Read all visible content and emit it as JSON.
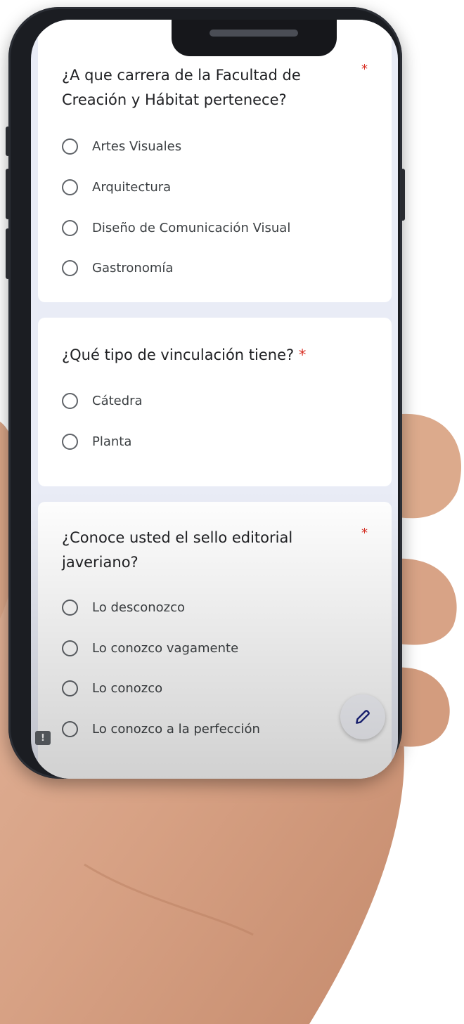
{
  "questions": [
    {
      "title": "¿A que carrera de la Facultad de Creación y Hábitat pertenece?",
      "required_mark": "*",
      "options": [
        "Artes Visuales",
        "Arquitectura",
        "Diseño de Comunicación Visual",
        "Gastronomía"
      ]
    },
    {
      "title": "¿Qué tipo de vinculación tiene?",
      "required_mark": "*",
      "options": [
        "Cátedra",
        "Planta"
      ]
    },
    {
      "title": "¿Conoce usted el sello editorial javeriano?",
      "required_mark": "*",
      "options": [
        "Lo desconozco",
        "Lo conozco vagamente",
        "Lo conozco",
        "Lo conozco a la perfección"
      ]
    }
  ],
  "report_badge": "!",
  "icons": {
    "fab": "pencil-icon",
    "report": "exclamation-icon"
  },
  "colors": {
    "required": "#d93025",
    "accent": "#1a237e",
    "background": "#e9ecf6"
  }
}
